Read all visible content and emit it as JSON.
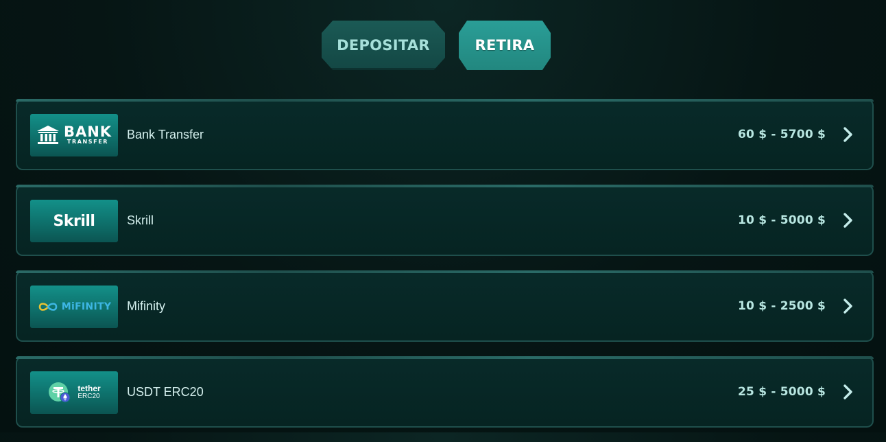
{
  "tabs": {
    "deposit_label": "DEPOSITAR",
    "withdraw_label": "RETIRA",
    "active": "withdraw"
  },
  "methods": [
    {
      "name": "Bank Transfer",
      "limits": "60 $ - 5700 $",
      "logo": {
        "icon": "bank-icon",
        "line1": "BANK",
        "line2": "TRANSFER"
      }
    },
    {
      "name": "Skrill",
      "limits": "10 $ - 5000 $",
      "logo": {
        "text": "Skrill"
      }
    },
    {
      "name": "Mifinity",
      "limits": "10 $ - 2500 $",
      "logo": {
        "icon": "infinity-icon",
        "text": "MiFINITY"
      }
    },
    {
      "name": "USDT ERC20",
      "limits": "25 $ - 5000 $",
      "logo": {
        "icon": "tether-icon",
        "line1": "tether",
        "line2": "ERC20"
      }
    }
  ],
  "colors": {
    "background": "#061514",
    "row": "#072725",
    "row_border": "#1f4f4c",
    "logo_tile": "#0f7772",
    "tab_active": "#269991",
    "tab_inactive": "#174f4b",
    "limits_text": "#b8e6e1"
  }
}
